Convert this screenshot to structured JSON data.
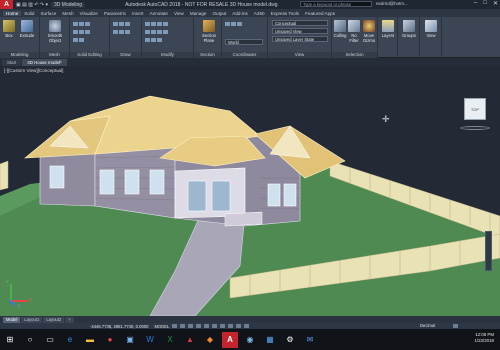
{
  "app": {
    "logo": "A",
    "title": "Autodesk AutoCAD 2018 - NOT FOR RESALE    3D House model.dwg",
    "workspace": "3D Modeling"
  },
  "search": {
    "placeholder": "Type a keyword or phrase"
  },
  "user": {
    "name": "nedrrid@hotm..."
  },
  "ribbon_tabs": [
    "Home",
    "Solid",
    "Surface",
    "Mesh",
    "Visualize",
    "Parametric",
    "Insert",
    "Annotate",
    "View",
    "Manage",
    "Output",
    "Add-ins",
    "A360",
    "Express Tools",
    "Featured Apps"
  ],
  "ribbon_active": "Home",
  "ribbon": {
    "modeling": {
      "title": "Modeling",
      "box": "Box",
      "extrude": "Extrude"
    },
    "mesh": {
      "title": "Mesh",
      "smooth": "Smooth\nObject"
    },
    "solid_editing": {
      "title": "Solid Editing"
    },
    "draw": {
      "title": "Draw"
    },
    "modify": {
      "title": "Modify"
    },
    "section": {
      "title": "Section",
      "plane": "Section\nPlane"
    },
    "coordinates": {
      "title": "Coordinates",
      "world": "World"
    },
    "view_panel": {
      "title": "View",
      "visual_style": "Conceptual",
      "saved_view": "Unsaved View",
      "unsaved_layer": "Unsaved Layer State"
    },
    "selection": {
      "title": "Selection",
      "culling": "Culling",
      "no_filter": "No Filter",
      "move_gizmo": "Move\nGizmo"
    },
    "layers": "Layers",
    "groups": "Groups",
    "view_btn": "View"
  },
  "doc_tabs": [
    "Start",
    "3D House model*"
  ],
  "doc_active": "3D House model*",
  "viewport": {
    "label": "[-][Custom View][Conceptual]",
    "viewcube": "TOP",
    "ucs_x": "X",
    "ucs_y": "Y",
    "ucs_z": "Z"
  },
  "layout_tabs": [
    "Model",
    "Layout1",
    "Layout2",
    "+"
  ],
  "layout_active": "Model",
  "status": {
    "coords": "-4446.7736, 2861.7740, 0.0000",
    "model": "MODEL",
    "units": "Decimal"
  },
  "taskbar": {
    "time": "12:08 PM",
    "date": "1/23/2018"
  },
  "colors": {
    "accent": "#c4242b",
    "sky": "#232a35",
    "grass": "#4e8a52",
    "roof": "#e4c77f",
    "wall": "#8f8a9e",
    "fence": "#e8e1b5"
  }
}
